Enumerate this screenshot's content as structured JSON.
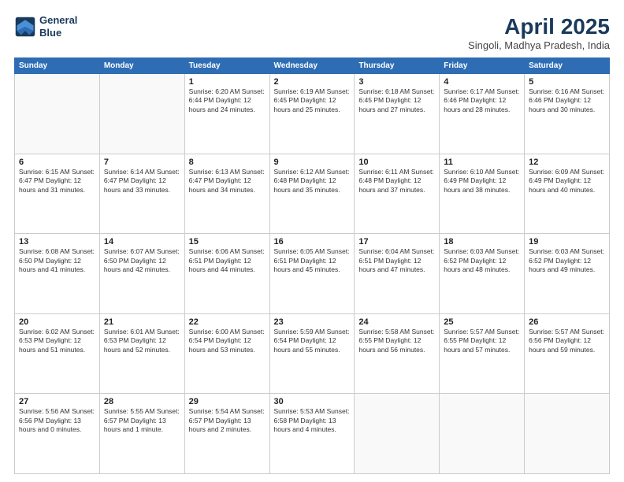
{
  "header": {
    "logo_line1": "General",
    "logo_line2": "Blue",
    "title": "April 2025",
    "subtitle": "Singoli, Madhya Pradesh, India"
  },
  "weekdays": [
    "Sunday",
    "Monday",
    "Tuesday",
    "Wednesday",
    "Thursday",
    "Friday",
    "Saturday"
  ],
  "weeks": [
    [
      {
        "day": "",
        "info": ""
      },
      {
        "day": "",
        "info": ""
      },
      {
        "day": "1",
        "info": "Sunrise: 6:20 AM\nSunset: 6:44 PM\nDaylight: 12 hours and 24 minutes."
      },
      {
        "day": "2",
        "info": "Sunrise: 6:19 AM\nSunset: 6:45 PM\nDaylight: 12 hours and 25 minutes."
      },
      {
        "day": "3",
        "info": "Sunrise: 6:18 AM\nSunset: 6:45 PM\nDaylight: 12 hours and 27 minutes."
      },
      {
        "day": "4",
        "info": "Sunrise: 6:17 AM\nSunset: 6:46 PM\nDaylight: 12 hours and 28 minutes."
      },
      {
        "day": "5",
        "info": "Sunrise: 6:16 AM\nSunset: 6:46 PM\nDaylight: 12 hours and 30 minutes."
      }
    ],
    [
      {
        "day": "6",
        "info": "Sunrise: 6:15 AM\nSunset: 6:47 PM\nDaylight: 12 hours and 31 minutes."
      },
      {
        "day": "7",
        "info": "Sunrise: 6:14 AM\nSunset: 6:47 PM\nDaylight: 12 hours and 33 minutes."
      },
      {
        "day": "8",
        "info": "Sunrise: 6:13 AM\nSunset: 6:47 PM\nDaylight: 12 hours and 34 minutes."
      },
      {
        "day": "9",
        "info": "Sunrise: 6:12 AM\nSunset: 6:48 PM\nDaylight: 12 hours and 35 minutes."
      },
      {
        "day": "10",
        "info": "Sunrise: 6:11 AM\nSunset: 6:48 PM\nDaylight: 12 hours and 37 minutes."
      },
      {
        "day": "11",
        "info": "Sunrise: 6:10 AM\nSunset: 6:49 PM\nDaylight: 12 hours and 38 minutes."
      },
      {
        "day": "12",
        "info": "Sunrise: 6:09 AM\nSunset: 6:49 PM\nDaylight: 12 hours and 40 minutes."
      }
    ],
    [
      {
        "day": "13",
        "info": "Sunrise: 6:08 AM\nSunset: 6:50 PM\nDaylight: 12 hours and 41 minutes."
      },
      {
        "day": "14",
        "info": "Sunrise: 6:07 AM\nSunset: 6:50 PM\nDaylight: 12 hours and 42 minutes."
      },
      {
        "day": "15",
        "info": "Sunrise: 6:06 AM\nSunset: 6:51 PM\nDaylight: 12 hours and 44 minutes."
      },
      {
        "day": "16",
        "info": "Sunrise: 6:05 AM\nSunset: 6:51 PM\nDaylight: 12 hours and 45 minutes."
      },
      {
        "day": "17",
        "info": "Sunrise: 6:04 AM\nSunset: 6:51 PM\nDaylight: 12 hours and 47 minutes."
      },
      {
        "day": "18",
        "info": "Sunrise: 6:03 AM\nSunset: 6:52 PM\nDaylight: 12 hours and 48 minutes."
      },
      {
        "day": "19",
        "info": "Sunrise: 6:03 AM\nSunset: 6:52 PM\nDaylight: 12 hours and 49 minutes."
      }
    ],
    [
      {
        "day": "20",
        "info": "Sunrise: 6:02 AM\nSunset: 6:53 PM\nDaylight: 12 hours and 51 minutes."
      },
      {
        "day": "21",
        "info": "Sunrise: 6:01 AM\nSunset: 6:53 PM\nDaylight: 12 hours and 52 minutes."
      },
      {
        "day": "22",
        "info": "Sunrise: 6:00 AM\nSunset: 6:54 PM\nDaylight: 12 hours and 53 minutes."
      },
      {
        "day": "23",
        "info": "Sunrise: 5:59 AM\nSunset: 6:54 PM\nDaylight: 12 hours and 55 minutes."
      },
      {
        "day": "24",
        "info": "Sunrise: 5:58 AM\nSunset: 6:55 PM\nDaylight: 12 hours and 56 minutes."
      },
      {
        "day": "25",
        "info": "Sunrise: 5:57 AM\nSunset: 6:55 PM\nDaylight: 12 hours and 57 minutes."
      },
      {
        "day": "26",
        "info": "Sunrise: 5:57 AM\nSunset: 6:56 PM\nDaylight: 12 hours and 59 minutes."
      }
    ],
    [
      {
        "day": "27",
        "info": "Sunrise: 5:56 AM\nSunset: 6:56 PM\nDaylight: 13 hours and 0 minutes."
      },
      {
        "day": "28",
        "info": "Sunrise: 5:55 AM\nSunset: 6:57 PM\nDaylight: 13 hours and 1 minute."
      },
      {
        "day": "29",
        "info": "Sunrise: 5:54 AM\nSunset: 6:57 PM\nDaylight: 13 hours and 2 minutes."
      },
      {
        "day": "30",
        "info": "Sunrise: 5:53 AM\nSunset: 6:58 PM\nDaylight: 13 hours and 4 minutes."
      },
      {
        "day": "",
        "info": ""
      },
      {
        "day": "",
        "info": ""
      },
      {
        "day": "",
        "info": ""
      }
    ]
  ]
}
